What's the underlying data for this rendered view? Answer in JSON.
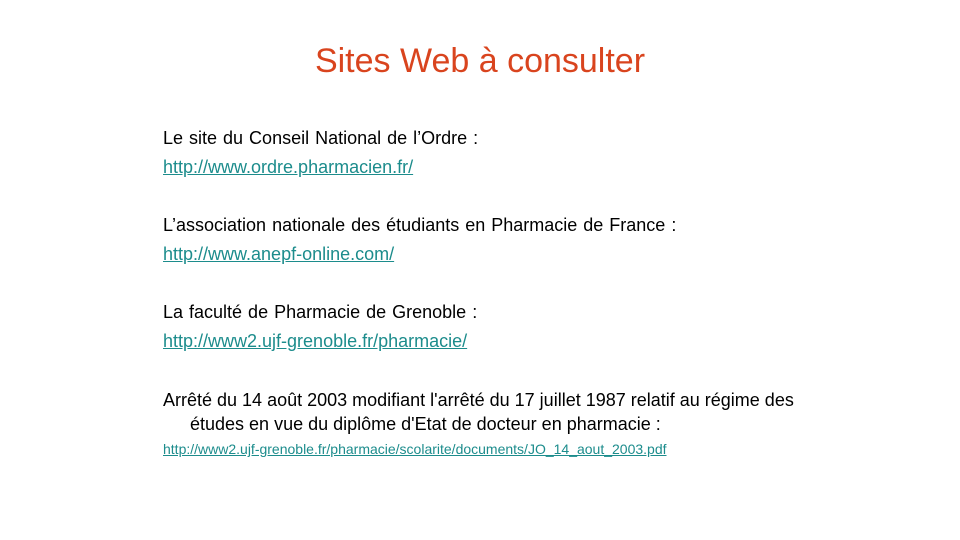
{
  "colors": {
    "title": "#D9441E",
    "link": "#1C8C8C",
    "text": "#000000",
    "background": "#FFFFFF"
  },
  "slide": {
    "title": "Sites Web à consulter",
    "entries": [
      {
        "label": "Le site du Conseil National de l’Ordre :",
        "link": "http://www.ordre.pharmacien.fr/"
      },
      {
        "label": "L’association nationale des étudiants en Pharmacie de France :",
        "link": "http://www.anepf-online.com/"
      },
      {
        "label": "La faculté de Pharmacie de Grenoble :",
        "link": "http://www2.ujf-grenoble.fr/pharmacie/"
      },
      {
        "label": "Arrêté du 14 août 2003 modifiant l'arrêté du 17 juillet 1987 relatif au régime des études en vue du diplôme d'Etat de docteur en pharmacie  :",
        "link": "http://www2.ujf-grenoble.fr/pharmacie/scolarite/documents/JO_14_aout_2003.pdf"
      }
    ]
  }
}
